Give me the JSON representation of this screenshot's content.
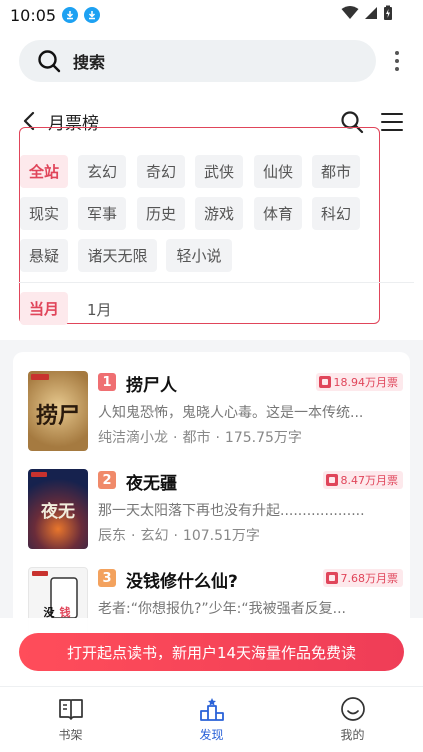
{
  "status_bar": {
    "time": "10:05"
  },
  "search": {
    "label": "搜索"
  },
  "header": {
    "title": "月票榜"
  },
  "filters": {
    "categories": [
      "全站",
      "玄幻",
      "奇幻",
      "武侠",
      "仙侠",
      "都市",
      "现实",
      "军事",
      "历史",
      "游戏",
      "体育",
      "科幻",
      "悬疑",
      "诸天无限",
      "轻小说"
    ],
    "active_category": "全站",
    "period_active": "当月",
    "month": "1月"
  },
  "books": [
    {
      "rank": "1",
      "title": "捞尸人",
      "tickets": "18.94万月票",
      "desc": "人知鬼恐怖，鬼晓人心毒。这是一本传统...",
      "author": "纯洁滴小龙",
      "genre": "都市",
      "words": "175.75万字",
      "cover_text": "捞尸人",
      "cover_color": "#b9925a"
    },
    {
      "rank": "2",
      "title": "夜无疆",
      "tickets": "8.47万月票",
      "desc": "那一天太阳落下再也没有升起...................",
      "author": "辰东",
      "genre": "玄幻",
      "words": "107.51万字",
      "cover_text": "夜无疆",
      "cover_color": "#1b2a5a"
    },
    {
      "rank": "3",
      "title": "没钱修什么仙?",
      "tickets": "7.68万月票",
      "desc": "老者:“你想报仇?”少年:“我被强者反复...",
      "author": "",
      "genre": "",
      "words": "",
      "cover_text": "没钱",
      "cover_color": "#f3f3f3"
    }
  ],
  "promo": {
    "text": "打开起点读书，新用户14天海量作品免费读"
  },
  "nav": [
    {
      "label": "书架",
      "icon": "book-icon"
    },
    {
      "label": "发现",
      "icon": "podium-icon",
      "active": true
    },
    {
      "label": "我的",
      "icon": "smile-icon"
    }
  ],
  "colors": {
    "accent": "#e0455a",
    "nav_active": "#2a62d8"
  }
}
